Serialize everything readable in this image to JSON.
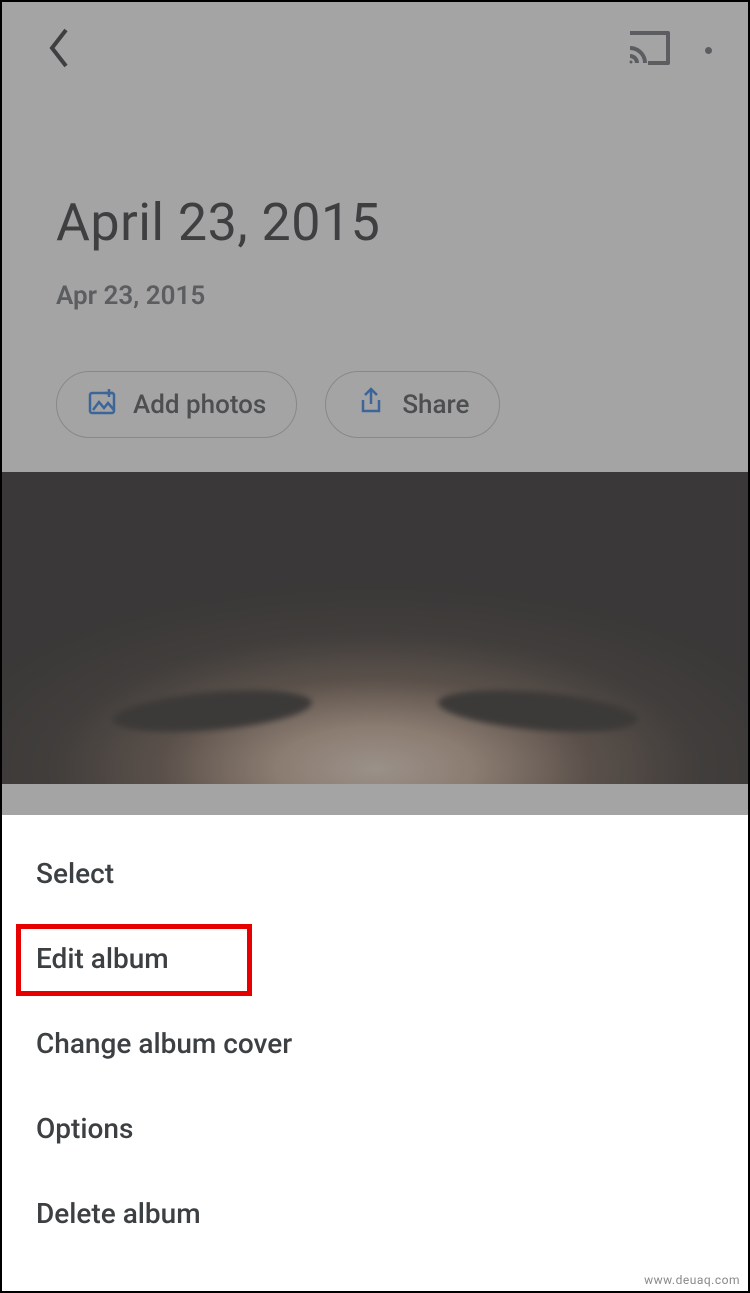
{
  "topbar": {
    "back": "Back",
    "cast": "Cast",
    "more": "More options"
  },
  "album": {
    "title": "April 23, 2015",
    "date": "Apr 23, 2015"
  },
  "actions": {
    "add_photos": "Add photos",
    "share": "Share"
  },
  "menu": {
    "select": "Select",
    "edit_album": "Edit album",
    "change_cover": "Change album cover",
    "options": "Options",
    "delete_album": "Delete album"
  },
  "watermark": "www.deuaq.com"
}
